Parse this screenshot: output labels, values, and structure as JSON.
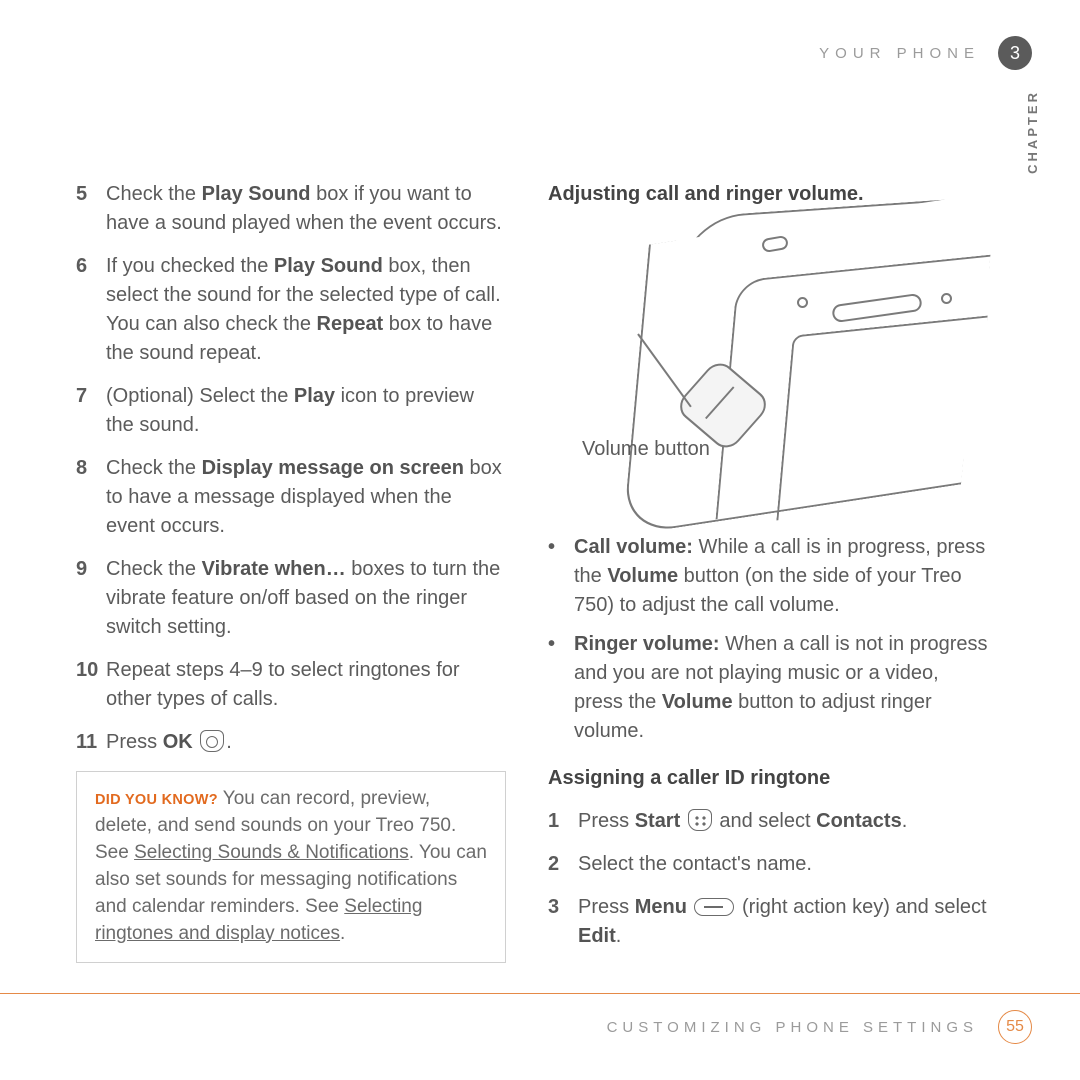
{
  "header": {
    "section": "YOUR PHONE",
    "chapter_num": "3",
    "side_label": "CHAPTER"
  },
  "left": {
    "steps": [
      {
        "n": "5",
        "html": "Check the <b>Play Sound</b> box if you want to have a sound played when the event occurs."
      },
      {
        "n": "6",
        "html": "If you checked the <b>Play Sound</b> box, then select the sound for the selected type of call. You can also check the <b>Repeat</b> box to have the sound repeat."
      },
      {
        "n": "7",
        "html": "(Optional) Select the <b>Play</b> icon to preview the sound."
      },
      {
        "n": "8",
        "html": "Check the <b>Display message on screen</b> box to have a message displayed when the event occurs."
      },
      {
        "n": "9",
        "html": "Check the <b>Vibrate when…</b> boxes to turn the vibrate feature on/off based on the ringer switch setting."
      },
      {
        "n": "10",
        "html": "Repeat steps 4–9 to select ringtones for other types of calls."
      },
      {
        "n": "11",
        "html": "Press <b>OK</b> <span class='icon-ok' data-name='ok-key-icon' data-interactable='false'></span>."
      }
    ],
    "tip": {
      "label": "DID YOU KNOW?",
      "html": "You can record, preview, delete, and send sounds on your Treo 750. See <span class='ul'>Selecting Sounds &amp; Notifications</span>. You can also set sounds for messaging notifications and calendar reminders. See <span class='ul'>Selecting ringtones and display notices</span>."
    }
  },
  "right": {
    "heading1": "Adjusting call and ringer volume.",
    "diagram_label": "Volume button",
    "bullets": [
      {
        "html": "<b>Call volume:</b> While a call is in progress, press the <b>Volume</b> button (on the side of your Treo 750) to adjust the call volume."
      },
      {
        "html": "<b>Ringer volume:</b> When a call is not in progress and you are not playing music or a video, press the <b>Volume</b> button to adjust ringer volume."
      }
    ],
    "heading2": "Assigning a caller ID ringtone",
    "steps2": [
      {
        "n": "1",
        "html": "Press <b>Start</b> <span class='icon-start' data-name='start-key-icon' data-interactable='false'></span> and select <b>Contacts</b>."
      },
      {
        "n": "2",
        "html": "Select the contact's name."
      },
      {
        "n": "3",
        "html": "Press <b>Menu</b> <span class='icon-menu' data-name='menu-key-icon' data-interactable='false'></span> (right action key) and select <b>Edit</b>."
      }
    ]
  },
  "footer": {
    "section": "CUSTOMIZING PHONE SETTINGS",
    "page": "55"
  }
}
